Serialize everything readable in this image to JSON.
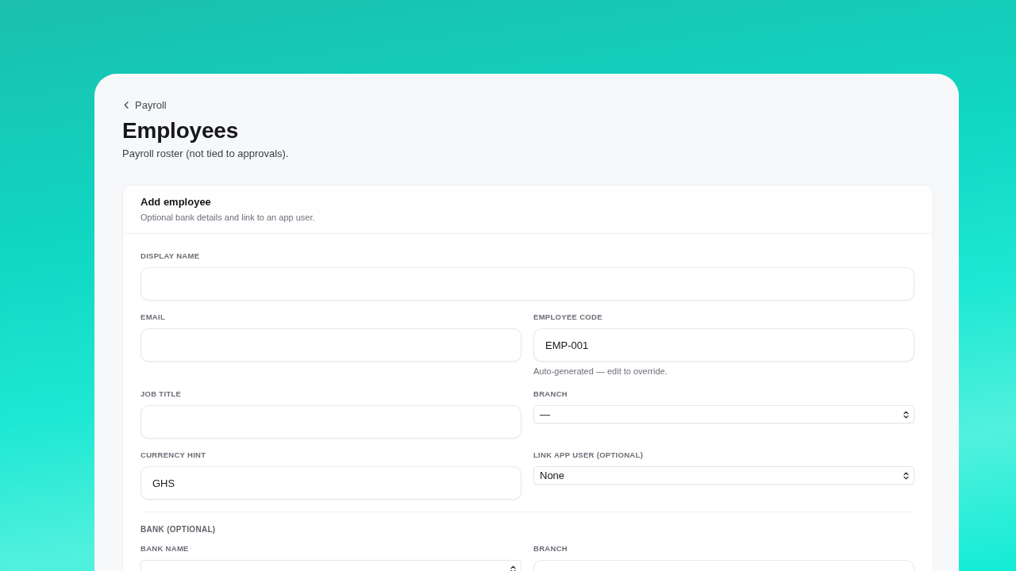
{
  "back_link": {
    "label": "Payroll"
  },
  "header": {
    "title": "Employees",
    "subtitle": "Payroll roster (not tied to approvals)."
  },
  "form": {
    "title": "Add employee",
    "subtitle": "Optional bank details and link to an app user.",
    "sections": [
      {
        "rows": [
          [
            {
              "label": "DISPLAY NAME",
              "kind": "text"
            }
          ],
          [
            {
              "label": "EMAIL",
              "kind": "text"
            },
            {
              "label": "EMPLOYEE CODE",
              "kind": "text",
              "value": "EMP-001",
              "hint": "Auto-generated — edit to override."
            }
          ],
          [
            {
              "label": "JOB TITLE",
              "kind": "text"
            },
            {
              "label": "BRANCH",
              "kind": "select",
              "value": "—"
            }
          ],
          [
            {
              "label": "CURRENCY HINT",
              "kind": "text",
              "value": "GHS"
            },
            {
              "label": "LINK APP USER (OPTIONAL)",
              "kind": "select",
              "value": "None"
            }
          ]
        ]
      },
      {
        "title": "BANK (OPTIONAL)",
        "rows": [
          [
            {
              "label": "BANK NAME",
              "kind": "select"
            },
            {
              "label": "BRANCH",
              "kind": "text"
            }
          ]
        ]
      }
    ]
  }
}
